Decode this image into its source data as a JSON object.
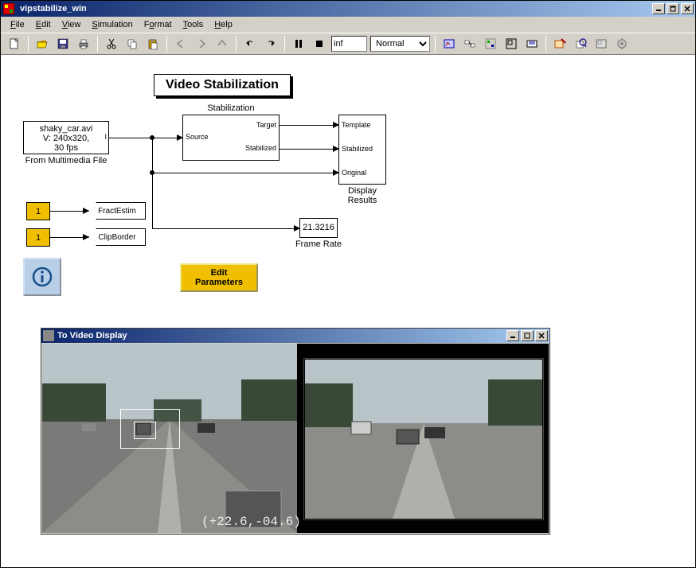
{
  "window": {
    "title": "vipstabilize_win"
  },
  "menu": [
    "File",
    "Edit",
    "View",
    "Simulation",
    "Format",
    "Tools",
    "Help"
  ],
  "toolbar": {
    "time": "inf",
    "mode": "Normal"
  },
  "diagram": {
    "title": "Video Stabilization",
    "source_block": {
      "line1": "shaky_car.avi",
      "line2": "V: 240x320,",
      "line3": "30 fps",
      "label": "From Multimedia File"
    },
    "stab_block": {
      "label": "Stabilization",
      "in": "Source",
      "out1": "Target",
      "out2": "Stabilized"
    },
    "display": {
      "label": "Display\nResults",
      "in1": "Template",
      "in2": "Stabilized",
      "in3": "Original"
    },
    "const1": "1",
    "const2": "1",
    "tag1": "FractEstim",
    "tag2": "ClipBorder",
    "frame_rate": "21.3216",
    "frame_rate_label": "Frame Rate",
    "edit_params": "Edit\nParameters"
  },
  "video": {
    "title": "To Video Display",
    "coords": "(+22.6,-04.6)"
  }
}
